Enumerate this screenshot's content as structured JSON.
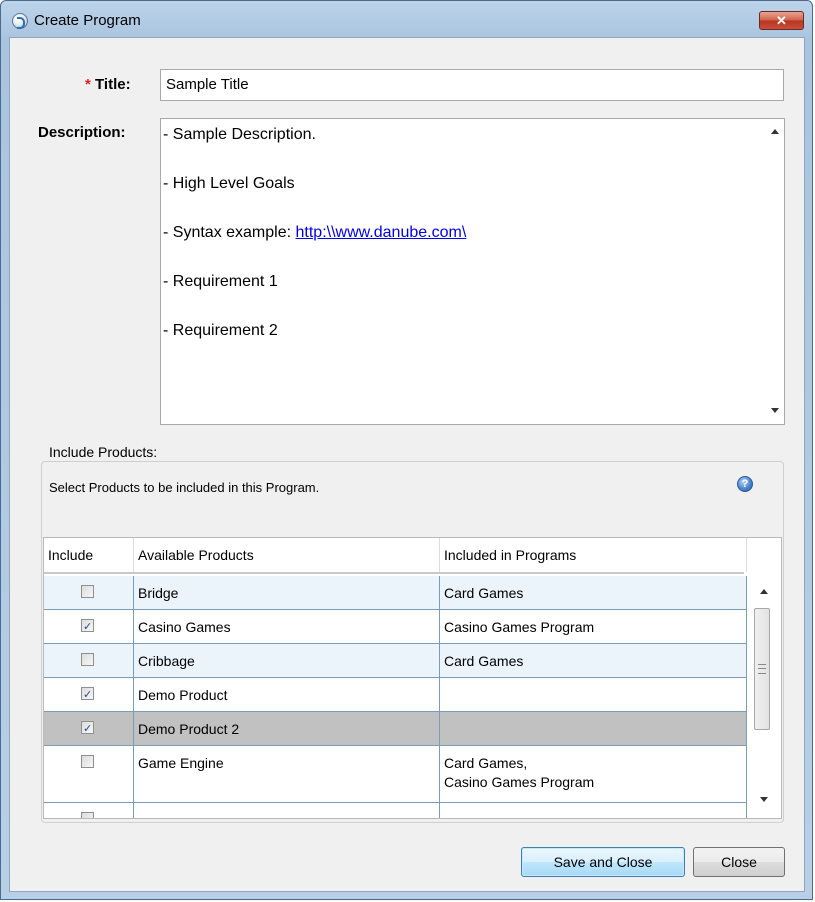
{
  "window": {
    "title": "Create Program",
    "close_glyph": "✕"
  },
  "form": {
    "title_required_mark": "*",
    "title_label": "Title:",
    "title_value": "Sample Title",
    "description_label": "Description:",
    "description_lines": [
      {
        "prefix": "- Sample Description.",
        "link": ""
      },
      {
        "prefix": "- High Level Goals",
        "link": ""
      },
      {
        "prefix": "- Syntax example: ",
        "link": "http:\\\\www.danube.com\\"
      },
      {
        "prefix": "- Requirement 1",
        "link": ""
      },
      {
        "prefix": "- Requirement 2",
        "link": ""
      }
    ]
  },
  "products": {
    "legend": "Include Products:",
    "hint": "Select Products to be included in this Program.",
    "help_glyph": "?",
    "columns": [
      "Include",
      "Available Products",
      "Included in Programs"
    ],
    "rows": [
      {
        "checked": false,
        "product": "Bridge",
        "programs": "Card Games"
      },
      {
        "checked": true,
        "product": "Casino Games",
        "programs": "Casino Games Program"
      },
      {
        "checked": false,
        "product": "Cribbage",
        "programs": "Card Games"
      },
      {
        "checked": true,
        "product": "Demo Product",
        "programs": ""
      },
      {
        "checked": true,
        "product": "Demo Product 2",
        "programs": ""
      },
      {
        "checked": false,
        "product": "Game Engine",
        "programs": "Card Games,\nCasino Games Program"
      },
      {
        "checked": false,
        "product": "",
        "programs": ""
      }
    ]
  },
  "buttons": {
    "save_and_close": "Save and Close",
    "close": "Close"
  },
  "colors": {
    "required_star": "#e02020",
    "link": "#0000ee",
    "selected_row": "#c1c1c1",
    "row_alt": "#ecf4fb"
  },
  "icons": {
    "app": "program-app-icon",
    "close": "close-icon",
    "help": "help-icon"
  }
}
